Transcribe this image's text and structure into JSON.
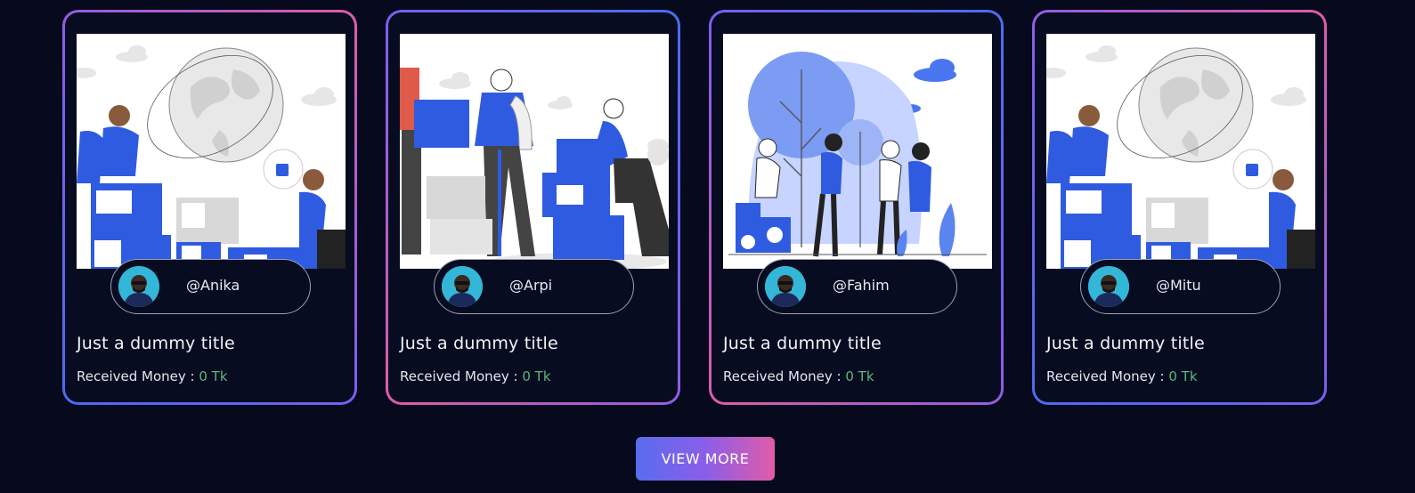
{
  "cards": [
    {
      "handle": "@Anika",
      "title": "Just a dummy title",
      "money_label": "Received Money :",
      "money_value": "0 Tk",
      "illustration": "globe-donation-illustration"
    },
    {
      "handle": "@Arpi",
      "title": "Just a dummy title",
      "money_label": "Received Money :",
      "money_value": "0 Tk",
      "illustration": "box-handover-illustration"
    },
    {
      "handle": "@Fahim",
      "title": "Just a dummy title",
      "money_label": "Received Money :",
      "money_value": "0 Tk",
      "illustration": "tree-donation-illustration"
    },
    {
      "handle": "@Mitu",
      "title": "Just a dummy title",
      "money_label": "Received Money :",
      "money_value": "0 Tk",
      "illustration": "globe-donation-illustration"
    }
  ],
  "view_more_label": "VIEW MORE",
  "colors": {
    "background": "#060a1c",
    "card_background": "#080c20",
    "accent_blue": "#4a6cf0",
    "accent_pink": "#e05ca8",
    "money_green": "#58b87a",
    "illustration_blue": "#2f5be0"
  }
}
